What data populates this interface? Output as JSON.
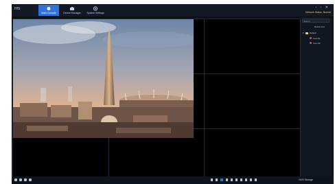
{
  "app": {
    "title": "HIS"
  },
  "tabs": [
    {
      "label": "Main Console",
      "icon": "eye-icon"
    },
    {
      "label": "Device Manager",
      "icon": "camera-icon"
    },
    {
      "label": "System Settings",
      "icon": "gear-icon"
    }
  ],
  "window_controls": "- ▫ ✕",
  "top_status": "Network Status: Normal",
  "sidebar": {
    "search_placeholder": "Search",
    "header_label": "Device List",
    "group": "Default",
    "devices": [
      "Cam 01",
      "Cam 02"
    ]
  },
  "bottombar": {
    "status": "NVR Storage"
  },
  "colors": {
    "accent": "#2e74d9",
    "background": "#0b0f16",
    "warning": "#f2c94c",
    "alert": "#d9534f"
  }
}
